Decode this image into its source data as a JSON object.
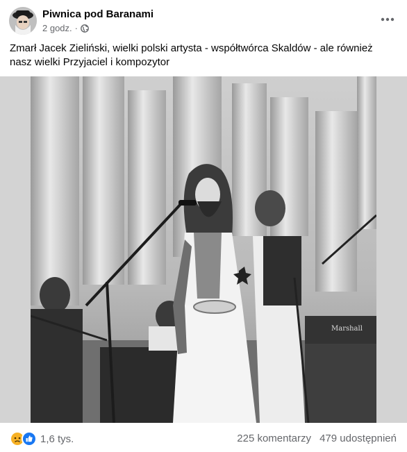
{
  "header": {
    "page_name": "Piwnica pod Baranami",
    "time": "2 godz.",
    "separator": "·",
    "privacy_icon": "globe-icon",
    "more_icon": "more-options-icon"
  },
  "post": {
    "text": "Zmarł Jacek Zieliński, wielki polski artysta - współtwórca Skaldów - ale również nasz wielki Przyjaciel i kompozytor"
  },
  "footer": {
    "reaction_icons": [
      "sad-reaction-icon",
      "like-reaction-icon"
    ],
    "reactions_count": "1,6 tys.",
    "comments": "225 komentarzy",
    "shares": "479 udostępnień"
  },
  "colors": {
    "text_primary": "#050505",
    "text_secondary": "#65676b",
    "like_blue": "#1877f2",
    "sad_yellow": "#f7b125"
  }
}
